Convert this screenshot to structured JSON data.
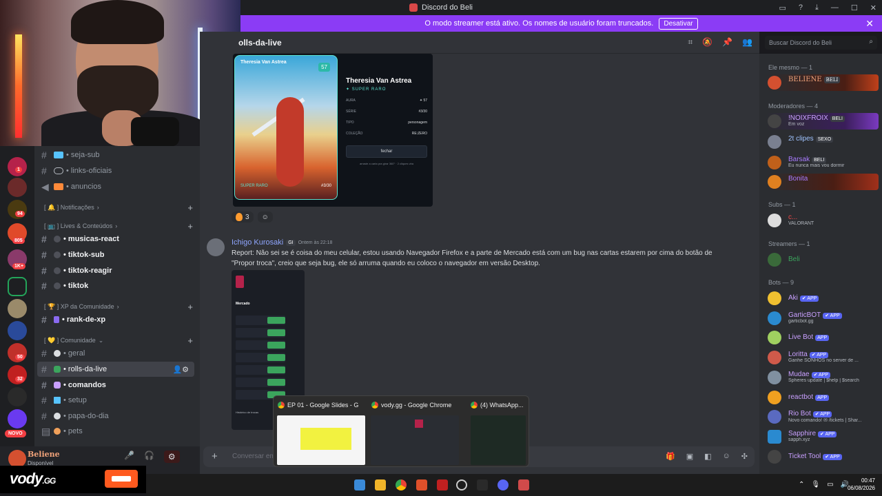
{
  "window": {
    "title": "Discord do Beli",
    "controls": [
      "inbox-icon",
      "help-icon",
      "download-icon",
      "minimize",
      "maximize",
      "close"
    ]
  },
  "banner": {
    "text": "O modo streamer está ativo. Os nomes de usuário foram truncados.",
    "button": "Desativar",
    "close": "✕"
  },
  "rail": {
    "badges": [
      "1",
      "94",
      "805",
      "1K+",
      "50",
      "32"
    ],
    "novo": "NOVO"
  },
  "channels": {
    "items": [
      {
        "name": "• seja-sub",
        "icon": "diamond-icon"
      },
      {
        "name": "• links-oficiais",
        "icon": "link-icon"
      },
      {
        "name": "• anuncios",
        "icon": "megaphone-icon"
      }
    ],
    "cat_notificacoes": "[ 🔔 ] Notificações",
    "cat_lives": "[ 📺 ] Lives & Conteúdos",
    "lives_items": [
      "• musicas-react",
      "• tiktok-sub",
      "• tiktok-reagir",
      "• tiktok"
    ],
    "cat_xp": "[ 🏆 ] XP da Comunidade",
    "xp_items": [
      "• rank-de-xp"
    ],
    "cat_comunidade": "[ 💛 ] Comunidade",
    "com_items": [
      "• geral",
      "• rolls-da-live",
      "• comandos",
      "• setup",
      "• papa-do-dia",
      "• pets"
    ]
  },
  "user": {
    "name": "Beliene",
    "status": "Disponível"
  },
  "vody": {
    "word": "vody",
    "suffix": ".GG"
  },
  "chat": {
    "channel": "olls-da-live",
    "search_placeholder": "Buscar Discord do Beli",
    "input_placeholder": "Conversar em"
  },
  "card": {
    "name": "Theresia Van Astrea",
    "rarity": "✦ SUPER RARO",
    "art_name": "Theresia Van Astrea",
    "art_level": "57",
    "art_rarity": "SUPER RARO",
    "art_num": "#3/30",
    "rows": [
      {
        "k": "AURA",
        "v": "✦ 57"
      },
      {
        "k": "SÉRIE",
        "v": "#3/30"
      },
      {
        "k": "TIPO",
        "v": "personagem"
      },
      {
        "k": "COLEÇÃO",
        "v": "RE:ZERO"
      }
    ],
    "button": "fechar",
    "hint": "arraste a carta pra girar 360° · 2 cliques vira"
  },
  "reactions": [
    {
      "emoji": "fire",
      "count": "3"
    }
  ],
  "message": {
    "author": "Ichigo Kurosaki",
    "tag": "GI",
    "time": "Ontem às 22:18",
    "text": "Report: Não sei se é coisa do meu celular, estou usando Navegador Firefox e a parte de Mercado está com um bug nas cartas estarem por cima do botão de \"Propor troca\", creio que seja bug, ele só arruma quando eu coloco o navegador em versão Desktop.",
    "shot_title": "Mercado",
    "shot_history": "Histórico de trocas"
  },
  "members": {
    "groups": [
      {
        "head": "Ele mesmo — 1",
        "list": [
          {
            "name": "BELIENE",
            "pill": "BELI",
            "color": "#f2a37a",
            "sub": ""
          }
        ]
      },
      {
        "head": "Moderadores — 4",
        "list": [
          {
            "name": "!NOIXFROIX",
            "pill": "BELI",
            "color": "#c9a0ff",
            "sub": "Em voz"
          },
          {
            "name": "2t clipes",
            "pill": "SEXO",
            "color": "#a0c4ff",
            "sub": ""
          },
          {
            "name": "Barsak",
            "pill": "BELI",
            "color": "#a97bff",
            "sub": "Eu nunca mais vou dormir"
          },
          {
            "name": "Bonita",
            "pill": "",
            "color": "#a97bff",
            "sub": ""
          }
        ]
      },
      {
        "head": "Subs — 1",
        "list": [
          {
            "name": "c...",
            "pill": "",
            "color": "#f04747",
            "sub": "VALORANT"
          }
        ]
      },
      {
        "head": "Streamers — 1",
        "list": [
          {
            "name": "Beli",
            "pill": "",
            "color": "#3ba55d",
            "sub": ""
          }
        ]
      },
      {
        "head": "Bots — 9",
        "list": [
          {
            "name": "Aki",
            "pill": "✔ APP",
            "color": "#c9a0ff",
            "sub": ""
          },
          {
            "name": "GarticBOT",
            "pill": "✔ APP",
            "color": "#c9a0ff",
            "sub": "garticbot.gg"
          },
          {
            "name": "Live Bot",
            "pill": "APP",
            "color": "#c9a0ff",
            "sub": ""
          },
          {
            "name": "Loritta",
            "pill": "✔ APP",
            "color": "#c9a0ff",
            "sub": "Ganhe SONHOS no server de ..."
          },
          {
            "name": "Mudae",
            "pill": "✔ APP",
            "color": "#c9a0ff",
            "sub": "Spheres update | $help | $search"
          },
          {
            "name": "reactbot",
            "pill": "APP",
            "color": "#c9a0ff",
            "sub": ""
          },
          {
            "name": "Rio Bot",
            "pill": "✔ APP",
            "color": "#c9a0ff",
            "sub": "Novo comando! ✉ /tickets | Shar..."
          },
          {
            "name": "Sapphire",
            "pill": "✔ APP",
            "color": "#c9a0ff",
            "sub": "sapph.xyz"
          },
          {
            "name": "Ticket Tool",
            "pill": "✔ APP",
            "color": "#c9a0ff",
            "sub": ""
          }
        ]
      }
    ]
  },
  "preview": [
    {
      "title": "EP 01 - Google Slides - G..."
    },
    {
      "title": "vody.gg - Google Chrome"
    },
    {
      "title": "(4) WhatsApp..."
    }
  ],
  "taskbar": {
    "time": "00:47",
    "date": "06/08/2026"
  }
}
